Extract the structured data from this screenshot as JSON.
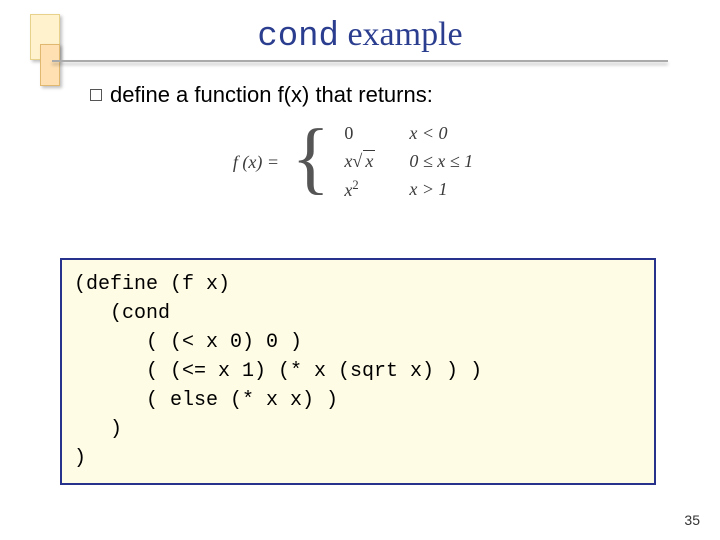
{
  "title": {
    "mono": "cond",
    "rest": " example"
  },
  "bullet": "define a function f(x) that returns:",
  "formula": {
    "lhs": "f (x) =",
    "cases": [
      {
        "value_html": "0",
        "condition": "x < 0"
      },
      {
        "value_html": "x√x",
        "condition": "0 ≤ x ≤ 1"
      },
      {
        "value_html": "x²",
        "condition": "x > 1"
      }
    ]
  },
  "code": "(define (f x)\n   (cond\n      ( (< x 0) 0 )\n      ( (<= x 1) (* x (sqrt x) ) )\n      ( else (* x x) )\n   )\n)",
  "page_number": "35"
}
